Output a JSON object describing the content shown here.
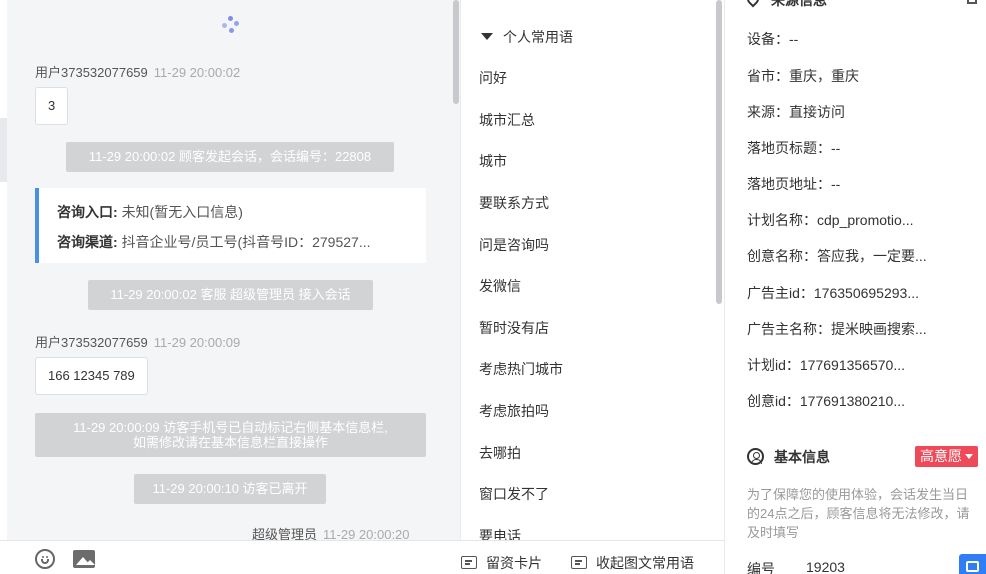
{
  "chat": {
    "messages": [
      {
        "sender": "用户373532077659",
        "time": "11-29 20:00:02",
        "text": "3"
      },
      {
        "sender": "用户373532077659",
        "time": "11-29 20:00:09",
        "text": "166 12345 789"
      }
    ],
    "system": {
      "session_start": "11-29 20:00:02 顾客发起会话，会话编号：22808",
      "agent_join": "11-29 20:00:02 客服 超级管理员 接入会话",
      "phone_notice_line1": "11-29 20:00:09 访客手机号已自动标记右侧基本信息栏,",
      "phone_notice_line2": "如需修改请在基本信息栏直接操作",
      "visitor_left": "11-29 20:00:10 访客已离开"
    },
    "entry_card": {
      "entry_label": "咨询入口:",
      "entry_value": "未知(暂无入口信息)",
      "channel_label": "咨询渠道:",
      "channel_value": "抖音企业号/员工号(抖音号ID：279527..."
    },
    "admin_sender": "超级管理员",
    "admin_time": "11-29 20:00:20"
  },
  "phrases": {
    "header": "个人常用语",
    "items": [
      "问好",
      "城市汇总",
      "城市",
      "要联系方式",
      "问是咨询吗",
      "发微信",
      "暂时没有店",
      "考虑热门城市",
      "考虑旅拍吗",
      "去哪拍",
      "窗口发不了",
      "要电话"
    ]
  },
  "toolbar": {
    "card_label": "留资卡片",
    "collapse_label": "收起图文常用语"
  },
  "source_info": {
    "title": "来源信息",
    "fields": [
      "设备：--",
      "省市：重庆，重庆",
      "来源：直接访问",
      "落地页标题：--",
      "落地页地址：--",
      "计划名称：cdp_promotio...",
      "创意名称：答应我，一定要...",
      "广告主id：176350695293...",
      "广告主名称：提米映画搜索...",
      "计划id：177691356570...",
      "创意id：177691380210..."
    ]
  },
  "basic_info": {
    "title": "基本信息",
    "intent_badge": "高意愿",
    "notice": "为了保障您的使用体验，会话发生当日的24点之后，顾客信息将无法修改，请及时填写",
    "id_label": "编号",
    "id_value": "19203"
  },
  "colors": {
    "accent": "#4a90e2",
    "badge": "#ef4a5a",
    "system_bubble": "#d2d3d5",
    "float_button": "#2f7ef5"
  }
}
